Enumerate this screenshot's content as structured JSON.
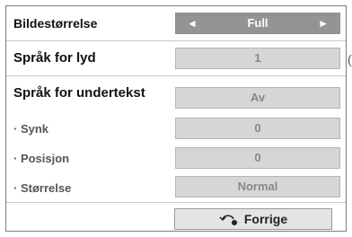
{
  "menu": {
    "rows": [
      {
        "label": "Bildestørrelse",
        "value": "Full"
      },
      {
        "label": "Språk for lyd",
        "value": "1"
      },
      {
        "label": "Språk for undertekst",
        "value": "Av"
      },
      {
        "label": "· Synk",
        "value": "0"
      },
      {
        "label": "· Posisjon",
        "value": "0"
      },
      {
        "label": "· Størrelse",
        "value": "Normal"
      }
    ],
    "arrow_left": "◄",
    "arrow_right": "►",
    "side_mark": "(",
    "back_label": "Forrige",
    "back_icon": "back-arrow-icon"
  },
  "colors": {
    "selected_value_bg": "#8f8f8f",
    "value_bg": "#d6d6d6",
    "panel_border": "#7c7c7c"
  }
}
